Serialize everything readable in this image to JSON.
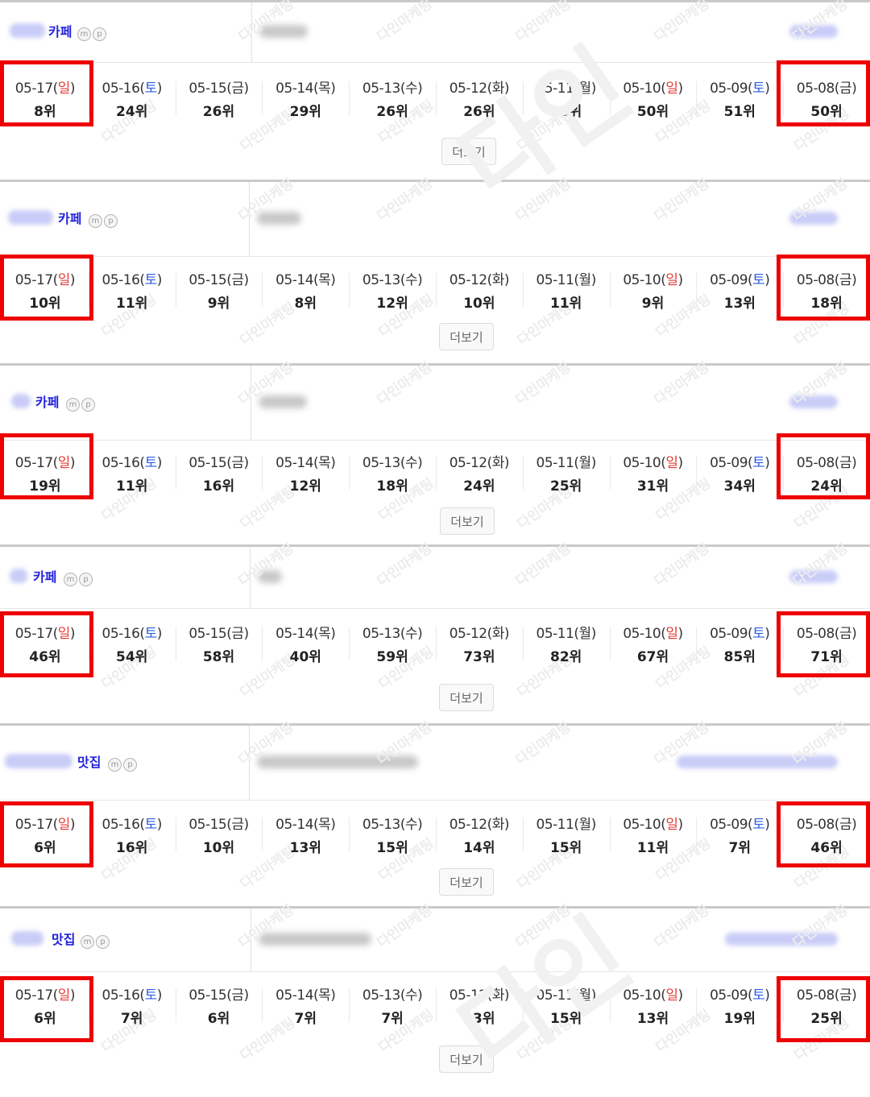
{
  "watermark": "다인마케팅",
  "watermark_logo": "다인",
  "more_label": "더보기",
  "blocks": [
    {
      "keyword": "카페",
      "ranks": [
        "8위",
        "24위",
        "26위",
        "29위",
        "26위",
        "26위",
        "29위",
        "50위",
        "51위",
        "50위"
      ]
    },
    {
      "keyword": "카페",
      "ranks": [
        "10위",
        "11위",
        "9위",
        "8위",
        "12위",
        "10위",
        "11위",
        "9위",
        "13위",
        "18위"
      ]
    },
    {
      "keyword": "카페",
      "ranks": [
        "19위",
        "11위",
        "16위",
        "12위",
        "18위",
        "24위",
        "25위",
        "31위",
        "34위",
        "24위"
      ]
    },
    {
      "keyword": "카페",
      "ranks": [
        "46위",
        "54위",
        "58위",
        "40위",
        "59위",
        "73위",
        "82위",
        "67위",
        "85위",
        "71위"
      ]
    },
    {
      "keyword": "맛집",
      "ranks": [
        "6위",
        "16위",
        "10위",
        "13위",
        "15위",
        "14위",
        "15위",
        "11위",
        "7위",
        "46위"
      ]
    },
    {
      "keyword": "맛집",
      "ranks": [
        "6위",
        "7위",
        "6위",
        "7위",
        "7위",
        "13위",
        "15위",
        "13위",
        "19위",
        "25위"
      ]
    }
  ],
  "dates": [
    {
      "date": "05-17",
      "day": "일",
      "type": "sun"
    },
    {
      "date": "05-16",
      "day": "토",
      "type": "sat"
    },
    {
      "date": "05-15",
      "day": "금",
      "type": "wk"
    },
    {
      "date": "05-14",
      "day": "목",
      "type": "wk"
    },
    {
      "date": "05-13",
      "day": "수",
      "type": "wk"
    },
    {
      "date": "05-12",
      "day": "화",
      "type": "wk"
    },
    {
      "date": "05-11",
      "day": "월",
      "type": "wk"
    },
    {
      "date": "05-10",
      "day": "일",
      "type": "sun"
    },
    {
      "date": "05-09",
      "day": "토",
      "type": "sat"
    },
    {
      "date": "05-08",
      "day": "금",
      "type": "wk"
    }
  ],
  "colors": {
    "highlight": "#ee0000",
    "sunday": "#e53935",
    "saturday": "#2c5ce0",
    "keyword": "#2222dd"
  }
}
